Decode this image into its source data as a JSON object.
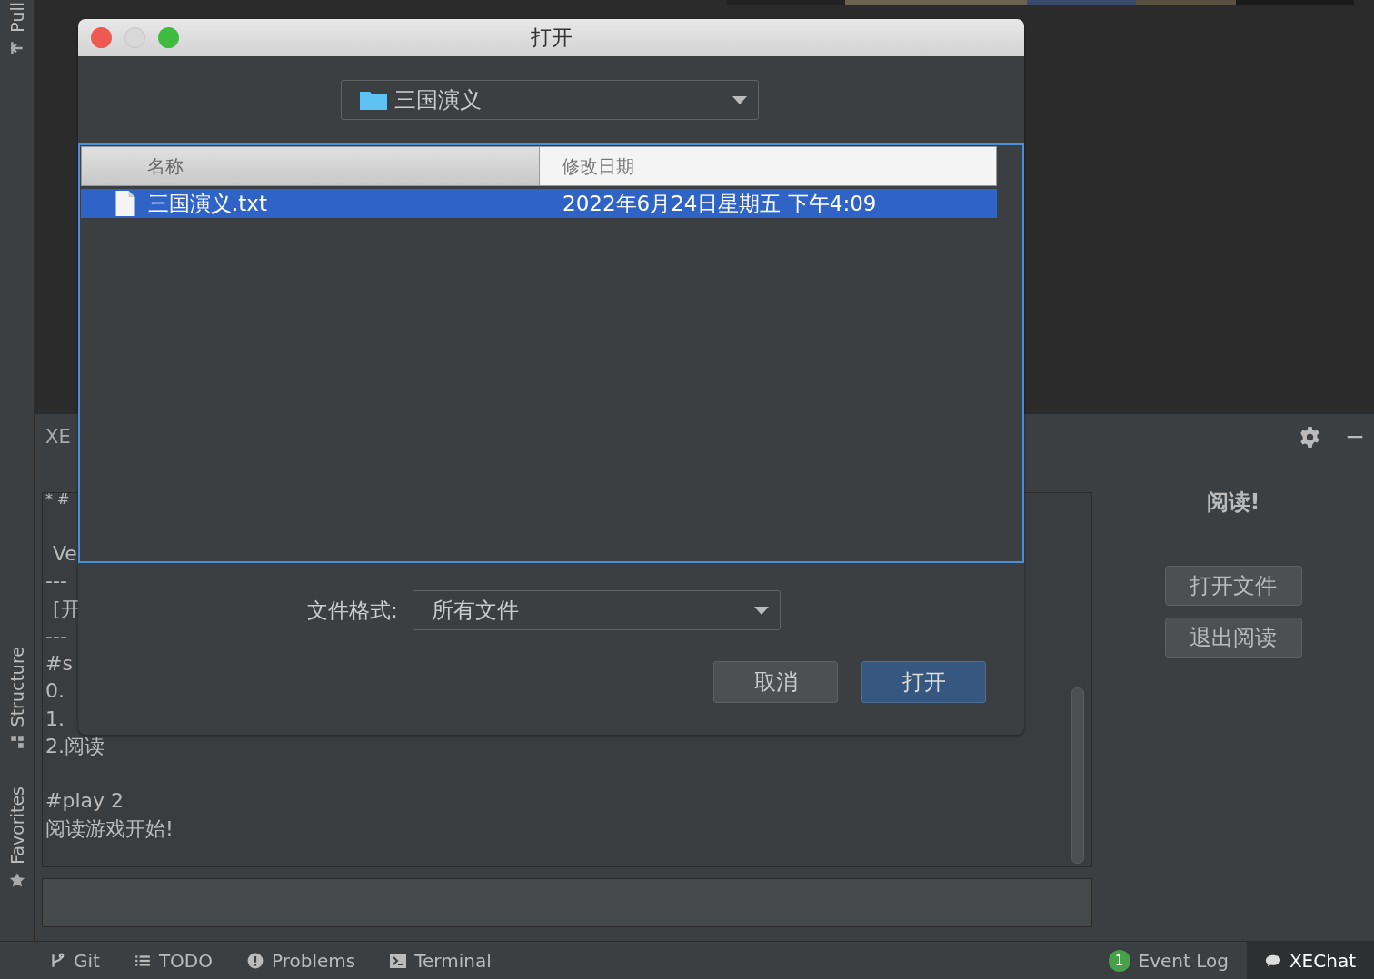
{
  "side_tool_strip": [
    {
      "label": "Pull",
      "kind": "pull"
    },
    {
      "label": "Structure",
      "kind": "structure"
    },
    {
      "label": "Favorites",
      "kind": "favorites"
    }
  ],
  "tool_window": {
    "title": "XE",
    "console_blocks": [
      [
        "* #"
      ],
      [
        "Ve",
        "---",
        "[开",
        "---",
        "#s",
        "0.",
        "1.",
        "2.阅读"
      ],
      [
        "#play 2",
        "阅读游戏开始!"
      ]
    ],
    "panel": {
      "title": "阅读!",
      "buttons": [
        "打开文件",
        "退出阅读"
      ]
    }
  },
  "dialog": {
    "title": "打开",
    "folder": "三国演义",
    "columns": [
      {
        "label": "名称",
        "selected": false
      },
      {
        "label": "修改日期",
        "selected": true
      }
    ],
    "rows": [
      {
        "name": "三国演义.txt",
        "modified": "2022年6月24日星期五 下午4:09",
        "selected": true
      }
    ],
    "format_label": "文件格式:",
    "format_value": "所有文件",
    "buttons": [
      {
        "label": "取消",
        "default": false
      },
      {
        "label": "打开",
        "default": true
      }
    ]
  },
  "status_bar": {
    "left_tools": [
      {
        "label": "Git",
        "kind": "git"
      },
      {
        "label": "TODO",
        "kind": "todo"
      },
      {
        "label": "Problems",
        "kind": "problems"
      },
      {
        "label": "Terminal",
        "kind": "terminal"
      }
    ],
    "right_tools": [
      {
        "label": "Event Log",
        "kind": "event",
        "badge": "1",
        "selected": false
      },
      {
        "label": "XEChat",
        "kind": "chat",
        "selected": true
      }
    ]
  }
}
